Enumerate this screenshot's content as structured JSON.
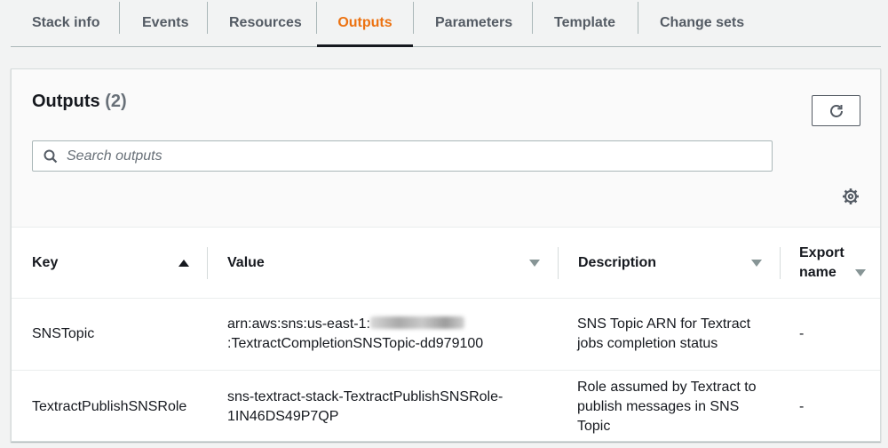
{
  "tabs": [
    {
      "label": "Stack info"
    },
    {
      "label": "Events"
    },
    {
      "label": "Resources"
    },
    {
      "label": "Outputs",
      "active": true
    },
    {
      "label": "Parameters"
    },
    {
      "label": "Template"
    },
    {
      "label": "Change sets"
    }
  ],
  "panel": {
    "title": "Outputs",
    "count": "(2)",
    "refresh_icon": "refresh-icon",
    "search_placeholder": "Search outputs",
    "search_value": "",
    "settings_icon": "gear-icon"
  },
  "table": {
    "columns": {
      "key": "Key",
      "value": "Value",
      "description": "Description",
      "export_line1": "Export",
      "export_line2": "name"
    },
    "sort": {
      "column": "Key",
      "direction": "ascending"
    },
    "rows": [
      {
        "key": "SNSTopic",
        "value_prefix": "arn:aws:sns:us-east-1:",
        "value_suffix": ":TextractCompletionSNSTopic-dd979100",
        "value_redacted": true,
        "description": "SNS Topic ARN for Textract jobs completion status",
        "export_name": "-"
      },
      {
        "key": "TextractPublishSNSRole",
        "value": "sns-textract-stack-TextractPublishSNSRole-1IN46DS49P7QP",
        "description": "Role assumed by Textract to publish messages in SNS Topic",
        "export_name": "-"
      }
    ]
  },
  "colors": {
    "accent": "#ec7211",
    "text": "#16191f",
    "muted": "#545b64",
    "background": "#f2f3f3"
  }
}
